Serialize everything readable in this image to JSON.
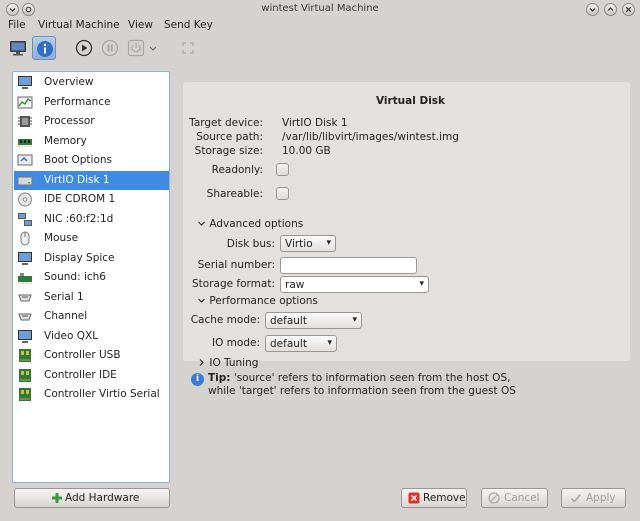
{
  "window": {
    "title": "wintest Virtual Machine"
  },
  "menu": [
    "File",
    "Virtual Machine",
    "View",
    "Send Key"
  ],
  "sidebar": {
    "items": [
      {
        "label": "Overview",
        "icon": "monitor-icon"
      },
      {
        "label": "Performance",
        "icon": "performance-icon"
      },
      {
        "label": "Processor",
        "icon": "processor-icon"
      },
      {
        "label": "Memory",
        "icon": "memory-icon"
      },
      {
        "label": "Boot Options",
        "icon": "boot-icon"
      },
      {
        "label": "VirtIO Disk 1",
        "icon": "disk-icon"
      },
      {
        "label": "IDE CDROM 1",
        "icon": "cdrom-icon"
      },
      {
        "label": "NIC :60:f2:1d",
        "icon": "nic-icon"
      },
      {
        "label": "Mouse",
        "icon": "mouse-icon"
      },
      {
        "label": "Display Spice",
        "icon": "display-icon"
      },
      {
        "label": "Sound: ich6",
        "icon": "sound-icon"
      },
      {
        "label": "Serial 1",
        "icon": "serial-icon"
      },
      {
        "label": "Channel",
        "icon": "channel-icon"
      },
      {
        "label": "Video QXL",
        "icon": "video-icon"
      },
      {
        "label": "Controller USB",
        "icon": "controller-icon"
      },
      {
        "label": "Controller IDE",
        "icon": "controller-icon"
      },
      {
        "label": "Controller Virtio Serial",
        "icon": "controller-icon"
      }
    ],
    "selected_index": 5
  },
  "panel": {
    "title": "Virtual Disk",
    "target_device_label": "Target device:",
    "target_device_value": "VirtIO Disk 1",
    "source_path_label": "Source path:",
    "source_path_value": "/var/lib/libvirt/images/wintest.img",
    "storage_size_label": "Storage size:",
    "storage_size_value": "10.00 GB",
    "readonly_label": "Readonly:",
    "shareable_label": "Shareable:",
    "advanced_label": "Advanced options",
    "disk_bus_label": "Disk bus:",
    "disk_bus_value": "Virtio",
    "serial_label": "Serial number:",
    "serial_value": "",
    "storage_format_label": "Storage format:",
    "storage_format_value": "raw",
    "performance_label": "Performance options",
    "cache_mode_label": "Cache mode:",
    "cache_mode_value": "default",
    "io_mode_label": "IO mode:",
    "io_mode_value": "default",
    "io_tuning_label": "IO Tuning"
  },
  "tip": {
    "prefix": "Tip:",
    "line1": "'source' refers to information seen from the host OS,",
    "line2": "while 'target' refers to information seen from the guest OS"
  },
  "buttons": {
    "add_hardware": "Add Hardware",
    "remove": "Remove",
    "cancel": "Cancel",
    "apply": "Apply"
  },
  "colors": {
    "selection": "#3f8ae2",
    "sidebar_border": "#8ab2de",
    "window_bg": "#d6d2d0",
    "panel_bg": "#e3e0de"
  }
}
